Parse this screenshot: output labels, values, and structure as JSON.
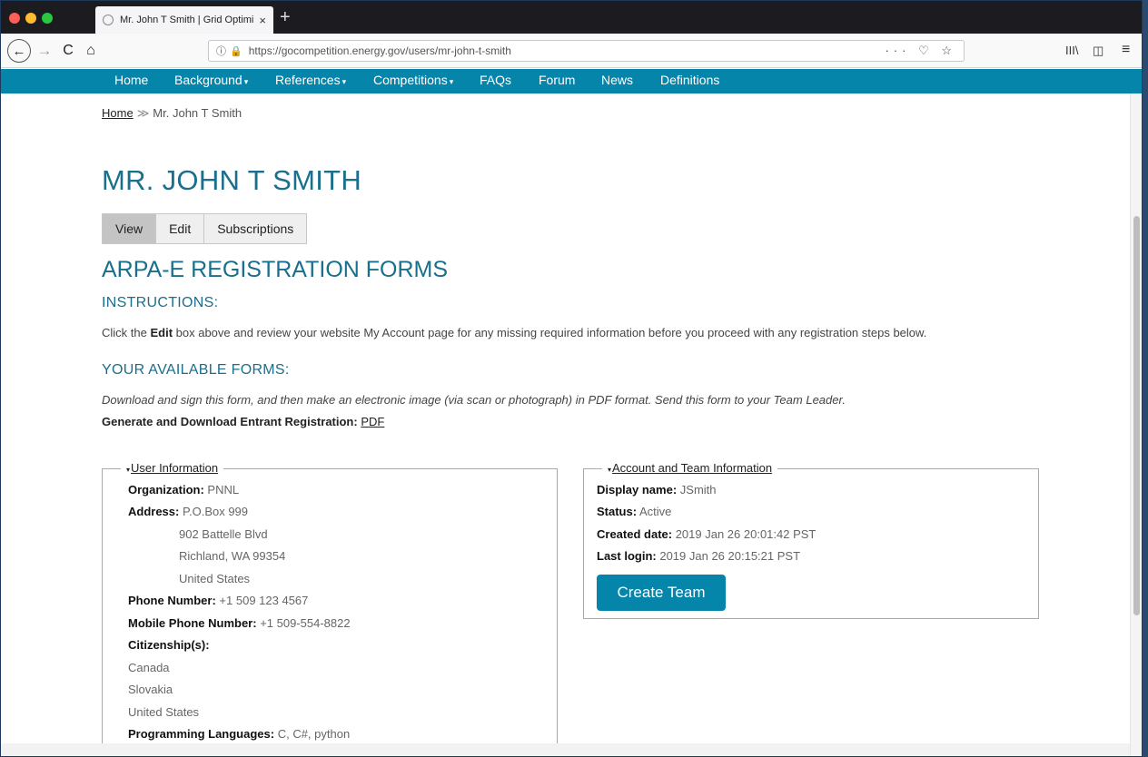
{
  "browser": {
    "tab_title": "Mr. John T Smith | Grid Optimiz",
    "tab_close": "×",
    "new_tab": "+",
    "url": "https://gocompetition.energy.gov/users/mr-john-t-smith",
    "url_icons": "··· ♡ ☆",
    "library_icon": "III\\",
    "sidebar_icon": "◫",
    "menu_icon": "≡",
    "back": "←",
    "forward": "→",
    "reload": "C",
    "home": "⌂"
  },
  "menu": [
    {
      "label": "Home",
      "caret": ""
    },
    {
      "label": "Background",
      "caret": "▾"
    },
    {
      "label": "References",
      "caret": "▾"
    },
    {
      "label": "Competitions",
      "caret": "▾"
    },
    {
      "label": "FAQs",
      "caret": ""
    },
    {
      "label": "Forum",
      "caret": ""
    },
    {
      "label": "News",
      "caret": ""
    },
    {
      "label": "Definitions",
      "caret": ""
    }
  ],
  "breadcrumb": {
    "home": "Home",
    "sep": "≫",
    "current": "Mr. John T Smith"
  },
  "page_title": "MR. JOHN T SMITH",
  "tabs": [
    "View",
    "Edit",
    "Subscriptions"
  ],
  "section_title": "ARPA-E REGISTRATION FORMS",
  "instructions": {
    "heading": "INSTRUCTIONS:",
    "pre": "Click the ",
    "bold": "Edit",
    "post": " box above and review your website My Account page for any missing required information before you proceed with any registration steps below."
  },
  "forms": {
    "heading": "YOUR AVAILABLE FORMS:",
    "note": "Download and sign this form, and then make an electronic image (via scan or photograph) in PDF format. Send this form to your Team Leader.",
    "generate_label": "Generate and Download Entrant Registration:",
    "pdf_link": "PDF"
  },
  "user_info": {
    "legend": "User Information",
    "organization_label": "Organization:",
    "organization": "PNNL",
    "address_label": "Address:",
    "address": [
      "P.O.Box 999",
      "902 Battelle Blvd",
      "Richland, WA 99354",
      "United States"
    ],
    "phone_label": "Phone Number:",
    "phone": "+1 509 123 4567",
    "mobile_label": "Mobile Phone Number:",
    "mobile": "+1 509-554-8822",
    "citizenship_label": "Citizenship(s):",
    "citizenships": [
      "Canada",
      "Slovakia",
      "United States"
    ],
    "languages_label": "Programming Languages:",
    "languages": "C, C#, python"
  },
  "account_info": {
    "legend": "Account and Team Information",
    "display_name_label": "Display name:",
    "display_name": "JSmith",
    "status_label": "Status:",
    "status": "Active",
    "created_label": "Created date:",
    "created": "2019 Jan 26 20:01:42 PST",
    "last_login_label": "Last login:",
    "last_login": "2019 Jan 26 20:15:21 PST",
    "create_team_button": "Create Team"
  },
  "colors": {
    "accent": "#0685ab",
    "heading": "#1a6f8c"
  }
}
